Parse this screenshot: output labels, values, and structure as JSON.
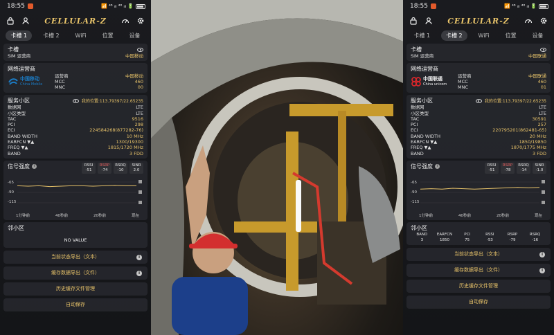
{
  "left": {
    "status": {
      "time": "18:55",
      "right": "📶 ⁴⁶ ᵢₗₗ ⁴⁶ ᵢₗₗ 🔋"
    },
    "app_title": "CELLULAR-Z",
    "tabs": [
      "卡槽 1",
      "卡槽 2",
      "WiFi",
      "位置",
      "设备"
    ],
    "active_tab": 0,
    "sim": {
      "title": "卡槽",
      "label": "SIM 运营商",
      "value": "中国移动"
    },
    "net": {
      "title": "网络运营商",
      "logo_line1": "中国移动",
      "logo_line2": "China Mobile",
      "rows": [
        {
          "k": "运营商",
          "v": "中国移动"
        },
        {
          "k": "MCC",
          "v": "460"
        },
        {
          "k": "MNC",
          "v": "00"
        }
      ]
    },
    "cell": {
      "title": "服务小区",
      "position": "我的位置:113.79397/22.65235",
      "rows": [
        {
          "k": "数据网",
          "v": "LTE"
        },
        {
          "k": "小区类型",
          "v": "LTE"
        },
        {
          "k": "TAC",
          "v": "9516"
        },
        {
          "k": "PCI",
          "v": "298"
        },
        {
          "k": "ECI",
          "v": "224584268(877282-76)"
        },
        {
          "k": "BAND WIDTH",
          "v": "10 MHz"
        },
        {
          "k": "EARFCN ▼▲",
          "v": "1300/19300"
        },
        {
          "k": "FREQ ▼▲",
          "v": "1815/1720 MHz"
        },
        {
          "k": "BAND",
          "v": "3 FDD"
        }
      ]
    },
    "signal": {
      "title": "信号强度",
      "metrics": [
        {
          "label": "RSSI",
          "value": "-51"
        },
        {
          "label": "RSRP",
          "value": "-74"
        },
        {
          "label": "RSRQ",
          "value": "-10"
        },
        {
          "label": "SINR",
          "value": "2.0"
        }
      ],
      "y_labels": [
        "-65",
        "-90",
        "-115"
      ],
      "time_labels": [
        "1分钟前",
        "40秒前",
        "20秒前",
        "现在"
      ],
      "trace": [
        -74,
        -75,
        -74,
        -76,
        -75,
        -74,
        -74,
        -75,
        -74,
        -73,
        -74,
        -74
      ]
    },
    "neighbor": {
      "title": "邻小区",
      "empty": "NO VALUE"
    },
    "actions": [
      "当前状态导出（文本）",
      "缓存数据导出（文件）",
      "历史缓存文件管理",
      "自动保存"
    ]
  },
  "right": {
    "status": {
      "time": "18:55",
      "right": "📶 ⁴⁶ ᵢₗₗ ⁴⁶ ᵢₗₗ 🔋"
    },
    "app_title": "CELLULAR-Z",
    "tabs": [
      "卡槽 1",
      "卡槽 2",
      "WiFi",
      "位置",
      "设备"
    ],
    "active_tab": 1,
    "sim": {
      "title": "卡槽",
      "label": "SIM 运营商",
      "value": "中国联通"
    },
    "net": {
      "title": "网络运营商",
      "logo_line1": "中国联通",
      "logo_line2": "China unicom",
      "rows": [
        {
          "k": "运营商",
          "v": "中国联通"
        },
        {
          "k": "MCC",
          "v": "460"
        },
        {
          "k": "MNC",
          "v": "01"
        }
      ]
    },
    "cell": {
      "title": "服务小区",
      "position": "我的位置:113.79397/22.65235",
      "rows": [
        {
          "k": "数据网",
          "v": "LTE"
        },
        {
          "k": "小区类型",
          "v": "LTE"
        },
        {
          "k": "TAC",
          "v": "30591"
        },
        {
          "k": "PCI",
          "v": "257"
        },
        {
          "k": "ECI",
          "v": "220795201(862481-65)"
        },
        {
          "k": "BAND WIDTH",
          "v": "20 MHz"
        },
        {
          "k": "EARFCN ▼▲",
          "v": "1850/19850"
        },
        {
          "k": "FREQ ▼▲",
          "v": "1870/1775 MHz"
        },
        {
          "k": "BAND",
          "v": "3 FDD"
        }
      ]
    },
    "signal": {
      "title": "信号强度",
      "metrics": [
        {
          "label": "RSSI",
          "value": "-51"
        },
        {
          "label": "RSRP",
          "value": "-78"
        },
        {
          "label": "RSRQ",
          "value": "-14"
        },
        {
          "label": "SINR",
          "value": "-1.0"
        }
      ],
      "y_labels": [
        "-65",
        "-90",
        "-115"
      ],
      "time_labels": [
        "1分钟前",
        "40秒前",
        "20秒前",
        "现在"
      ],
      "trace": [
        -82,
        -81,
        -82,
        -80,
        -81,
        -82,
        -81,
        -80,
        -79,
        -78,
        -79,
        -78
      ]
    },
    "neighbor": {
      "title": "邻小区",
      "headers": [
        "BAND",
        "EARFCN",
        "PCI",
        "RSSI",
        "RSRP",
        "RSRQ"
      ],
      "row": [
        "3",
        "1850",
        "75",
        "-53",
        "-79",
        "-16"
      ]
    },
    "actions": [
      "当前状态导出（文本）",
      "缓存数据导出（文件）",
      "历史缓存文件管理",
      "自动保存"
    ]
  },
  "colors": {
    "accent": "#e9c46a",
    "rsrp_highlight": "#e85d5d",
    "card": "#26272c",
    "mobile_blue": "#1b7bc4",
    "unicom_red": "#d7262b"
  }
}
